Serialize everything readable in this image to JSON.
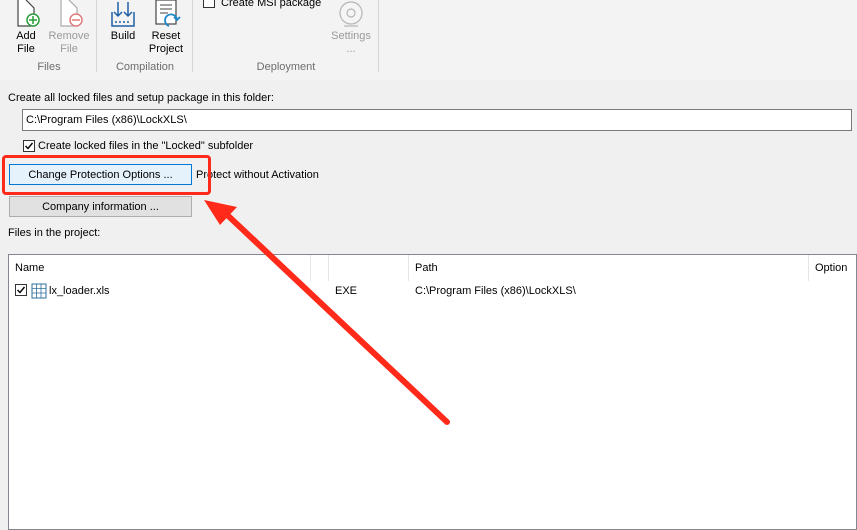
{
  "ribbon": {
    "files_group": {
      "label": "Files",
      "add_file": {
        "line1": "Add",
        "line2": "File"
      },
      "remove_file": {
        "line1": "Remove",
        "line2": "File"
      }
    },
    "compilation_group": {
      "label": "Compilation",
      "build": {
        "line1": "Build"
      },
      "reset_project": {
        "line1": "Reset",
        "line2": "Project"
      }
    },
    "deployment_group": {
      "label": "Deployment",
      "create_msi": {
        "label": "Create MSI package",
        "checked": false
      },
      "settings": {
        "line1": "Settings",
        "line2": "..."
      }
    }
  },
  "folder": {
    "label": "Create all locked files and setup package in this folder:",
    "path": "C:\\Program Files (x86)\\LockXLS\\"
  },
  "locked_subfolder": {
    "label": "Create locked files in the \"Locked\" subfolder",
    "checked": true
  },
  "change_protection_button": "Change Protection Options ...",
  "protection_mode": "Protect without Activation",
  "company_info_button": "Company information ...",
  "files_label": "Files in the project:",
  "table": {
    "columns": [
      "Name",
      "",
      "Path",
      "Option"
    ],
    "rows": [
      {
        "checked": true,
        "icon": "excel-file-icon",
        "name": "lx_loader.xls",
        "type": "EXE",
        "path": "C:\\Program Files (x86)\\LockXLS\\"
      }
    ]
  },
  "annotation_color": "#ff2a1a"
}
